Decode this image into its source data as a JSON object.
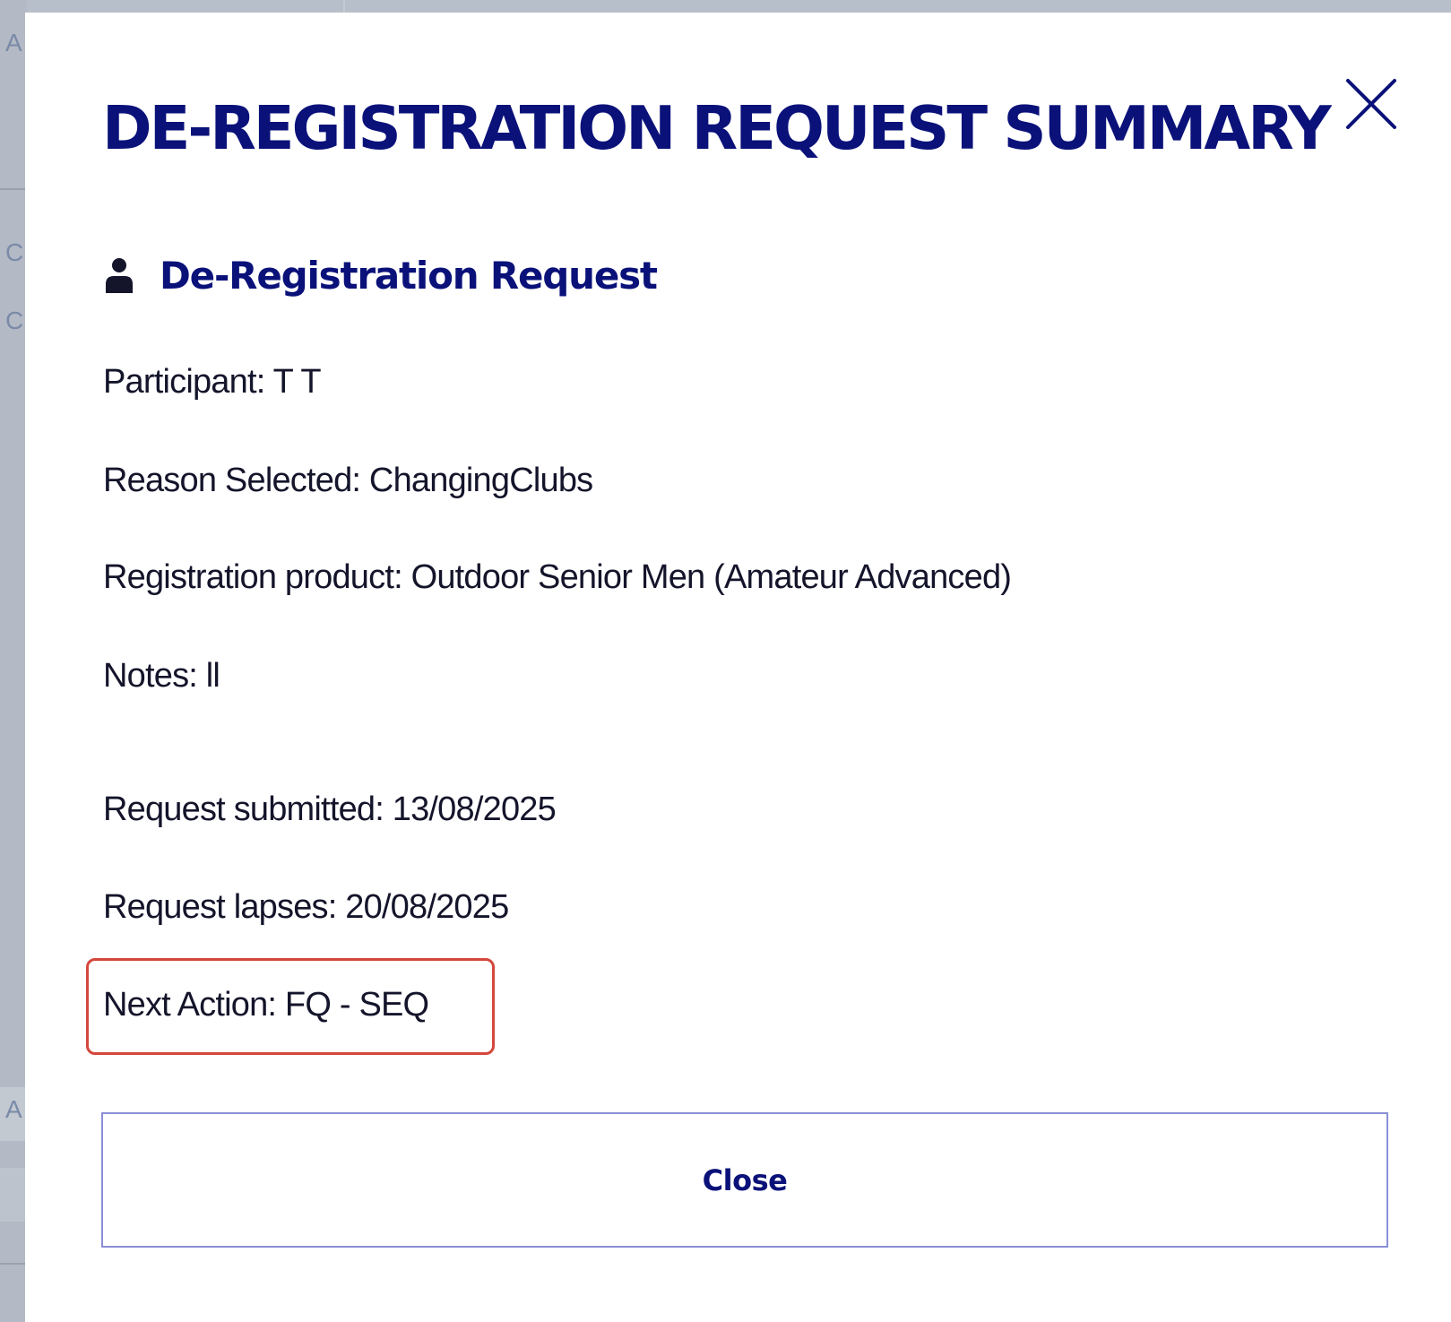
{
  "background": {
    "peek_letters": [
      "A",
      "C",
      "C",
      "A"
    ]
  },
  "modal": {
    "title": "DE-REGISTRATION REQUEST SUMMARY",
    "close_icon": "close-icon",
    "section": {
      "icon": "person-icon",
      "title": "De-Registration Request"
    },
    "fields": {
      "participant": "Participant: T T",
      "reason": "Reason Selected: ChangingClubs",
      "product": "Registration product: Outdoor Senior Men (Amateur Advanced)",
      "notes": "Notes: ll",
      "submitted": "Request submitted: 13/08/2025",
      "lapses": "Request lapses: 20/08/2025",
      "next_action": "Next Action: FQ - SEQ"
    },
    "close_button_label": "Close"
  },
  "colors": {
    "brand": "#0a1179",
    "highlight": "#d4473c",
    "button_border": "#8a8fd6"
  }
}
